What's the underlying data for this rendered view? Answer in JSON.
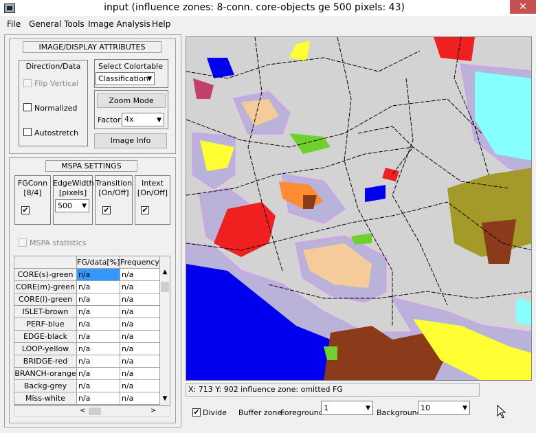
{
  "window": {
    "title": "input (influence zones: 8-conn. core-objects ge 500 pixels: 43)",
    "close_icon": "✕"
  },
  "menu": [
    "File",
    "General Tools",
    "Image Analysis",
    "Help"
  ],
  "image_display": {
    "header": "IMAGE/DISPLAY ATTRIBUTES",
    "direction_label": "Direction/Data",
    "flip_vertical": "Flip Vertical",
    "normalized": "Normalized",
    "autostretch": "Autostretch",
    "select_colortable": "Select Colortable",
    "colortable_value": "Classification",
    "zoom_mode": "Zoom Mode",
    "factor_label": "Factor:",
    "factor_value": "4x",
    "image_info": "Image Info"
  },
  "mspa": {
    "header": "MSPA SETTINGS",
    "fgconn": [
      "FGConn",
      "[8/4]"
    ],
    "edgewidth": [
      "EdgeWidth",
      "[pixels]"
    ],
    "edgewidth_value": "500",
    "transition": [
      "Transition",
      "[On/Off]"
    ],
    "intext": [
      "Intext",
      "[On/Off]"
    ],
    "fgconn_checked": true,
    "transition_checked": true,
    "intext_checked": true,
    "statistics": "MSPA statistics"
  },
  "table": {
    "columns": [
      "FG/data[%]",
      "Frequency"
    ],
    "rows": [
      {
        "label": "CORE(s)-green",
        "fg": "n/a",
        "freq": "n/a"
      },
      {
        "label": "CORE(m)-green",
        "fg": "n/a",
        "freq": "n/a"
      },
      {
        "label": "CORE(l)-green",
        "fg": "n/a",
        "freq": "n/a"
      },
      {
        "label": "ISLET-brown",
        "fg": "n/a",
        "freq": "n/a"
      },
      {
        "label": "PERF-blue",
        "fg": "n/a",
        "freq": "n/a"
      },
      {
        "label": "EDGE-black",
        "fg": "n/a",
        "freq": "n/a"
      },
      {
        "label": "LOOP-yellow",
        "fg": "n/a",
        "freq": "n/a"
      },
      {
        "label": "BRIDGE-red",
        "fg": "n/a",
        "freq": "n/a"
      },
      {
        "label": "BRANCH-orange",
        "fg": "n/a",
        "freq": "n/a"
      },
      {
        "label": "Backg-grey",
        "fg": "n/a",
        "freq": "n/a"
      },
      {
        "label": "Miss-white",
        "fg": "n/a",
        "freq": "n/a"
      }
    ],
    "selected_color": "#3399ff"
  },
  "status": {
    "text": "X: 713   Y: 902   influence zone: omitted FG"
  },
  "bottom": {
    "divide": "Divide",
    "divide_checked": true,
    "buffer_zone": "Buffer zone:",
    "foreground_label": "Foreground:",
    "foreground_value": "1",
    "background_label": "Background",
    "background_value": "10"
  },
  "colors": {
    "map_bg": "#d3d3d3",
    "halo": "#c4b4e6",
    "accent_red": "#c75050"
  }
}
